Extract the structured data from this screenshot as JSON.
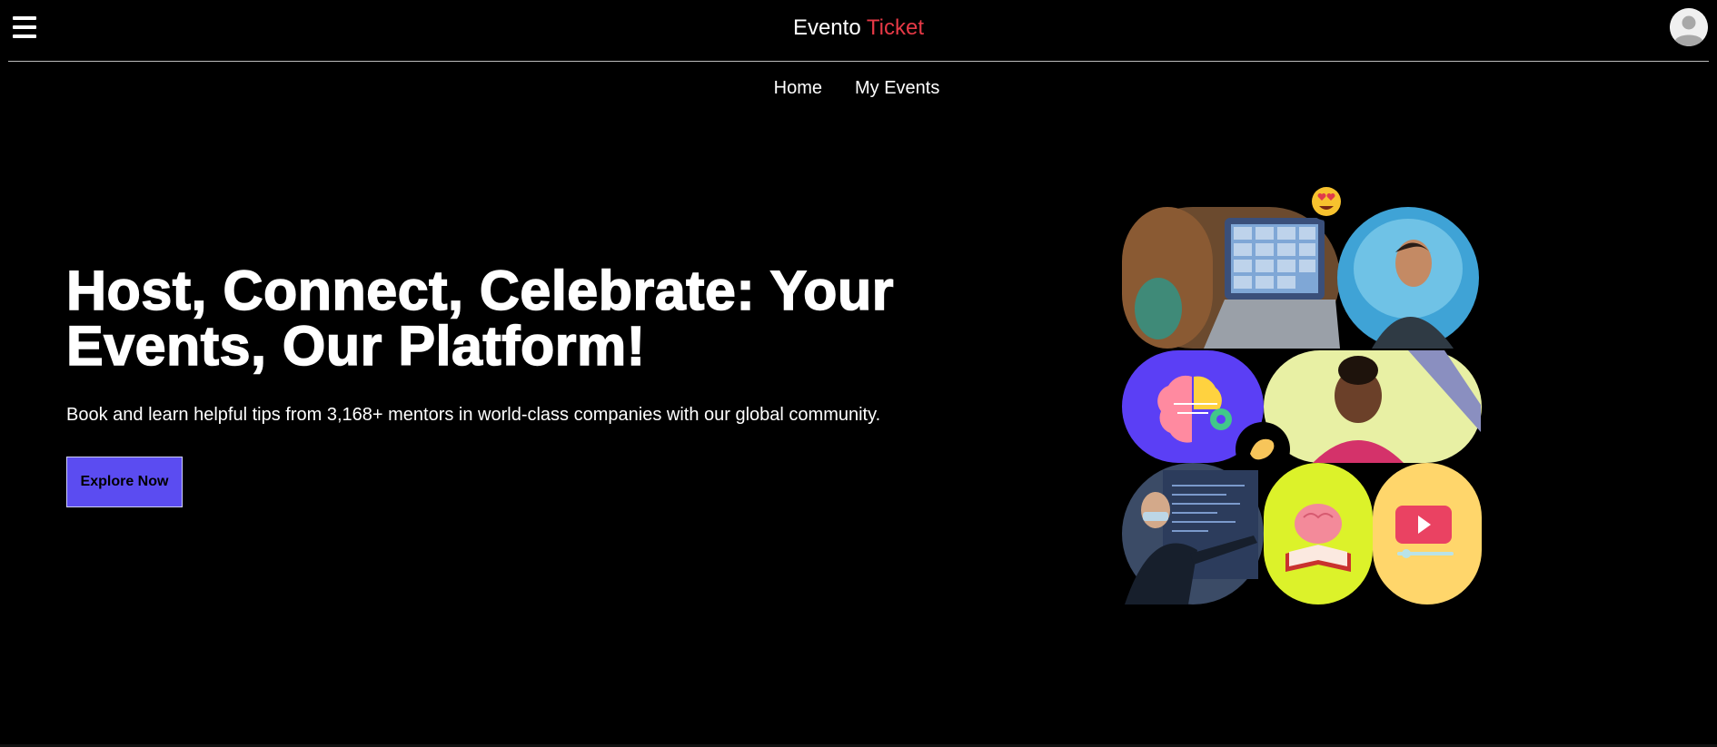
{
  "header": {
    "brand_main": "Evento",
    "brand_accent": "Ticket",
    "menu_icon": "hamburger-menu-icon",
    "avatar_icon": "user-avatar-icon"
  },
  "nav": {
    "items": [
      {
        "label": "Home"
      },
      {
        "label": "My Events"
      }
    ]
  },
  "hero": {
    "title_line1": "Host, Connect, Celebrate: Your",
    "title_line2": "Events, Our Platform!",
    "subtitle": "Book and learn helpful tips from 3,168+ mentors in world-class companies with our global community.",
    "cta_label": "Explore Now"
  },
  "colors": {
    "background": "#000000",
    "accent": "#e63946",
    "button": "#5b4cf1",
    "tile_purple": "#5b3ff5",
    "tile_lime": "#dcf22a",
    "tile_yellow": "#ffd66b"
  }
}
